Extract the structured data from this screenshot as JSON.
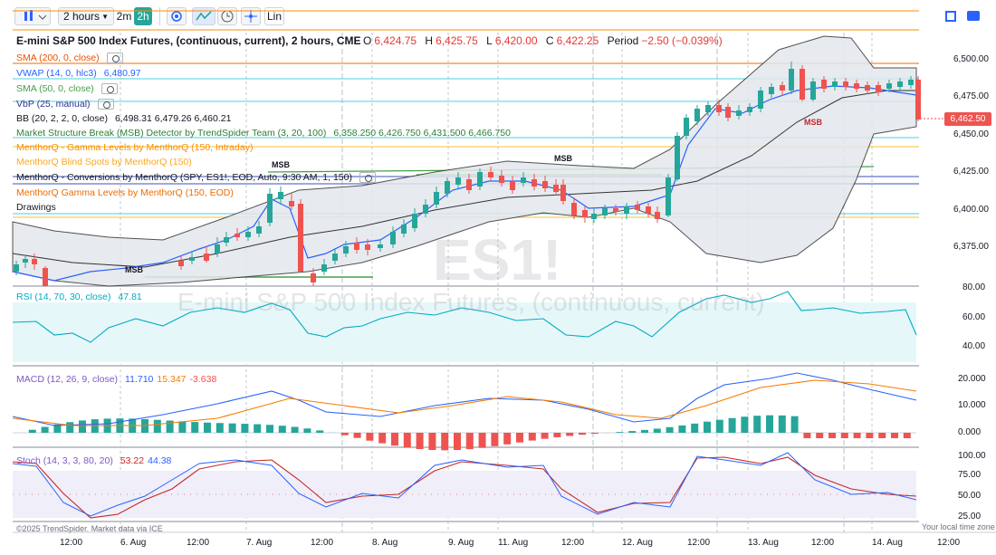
{
  "toolbar": {
    "interval_label": "2 hours",
    "btn_2m": "2m",
    "btn_2h": "2h",
    "lin_label": "Lin"
  },
  "chart": {
    "title": "E-mini S&P 500 Index Futures, (continuous, current), 2 hours, CME",
    "watermark_symbol": "ES1!",
    "watermark_name": "E-mini S&P 500 Index Futures, (continuous, current)",
    "ohlc": {
      "o_label": "O",
      "o": "6,424.75",
      "h_label": "H",
      "h": "6,425.75",
      "l_label": "L",
      "l": "6,420.00",
      "c_label": "C",
      "c": "6,422.25",
      "period_label": "Period",
      "period": "−2.50 (−0.039%)"
    },
    "last_price": "6,462.50"
  },
  "legends": {
    "sma200": "SMA (200, 0, close)",
    "vwap": "VWAP (14, 0, hlc3)",
    "vwap_val": "6,480.97",
    "sma50": "SMA (50, 0, close)",
    "vbp": "VbP (25, manual)",
    "bb": "BB (20, 2, 2, 0, close)",
    "bb_vals": "6,498.31  6,479.26  6,460.21",
    "msb": "Market Structure Break (MSB) Detector by TrendSpider Team (3, 20, 100)",
    "msb_vals": "6,358.250  6,426.750  6,431.500  6,466.750",
    "gamma_intraday": "MenthorQ - Gamma Levels by MenthorQ (150, Intraday)",
    "blind_spots": "MenthorQ Blind Spots by MenthorQ (150)",
    "conversions": "MenthorQ - Conversions by MenthorQ (SPY, ES1!, EOD, Auto, 9:30 AM, 1, 150)",
    "gamma_eod": "MenthorQ Gamma Levels by MenthorQ (150, EOD)",
    "drawings": "Drawings",
    "rsi": "RSI (14, 70, 30, close)",
    "rsi_val": "47.81",
    "macd": "MACD (12, 26, 9, close)",
    "macd_v1": "11.710",
    "macd_v2": "15.347",
    "macd_v3": "-3.638",
    "stoch": "Stoch (14, 3, 3, 80, 20)",
    "stoch_v1": "53.22",
    "stoch_v2": "44.38"
  },
  "labels": {
    "msb1": "MSB",
    "msb2": "MSB",
    "msb3": "MSB",
    "msb4": "MSB"
  },
  "price_axis": [
    "6,500.00",
    "6,475.00",
    "6,450.00",
    "6,425.00",
    "6,400.00",
    "6,375.00"
  ],
  "rsi_axis": [
    "80.00",
    "60.00",
    "40.00"
  ],
  "macd_axis": [
    "20.000",
    "10.000",
    "0.000"
  ],
  "stoch_axis": [
    "100.00",
    "75.00",
    "50.00",
    "25.00"
  ],
  "time_axis": [
    "12:00",
    "6. Aug",
    "12:00",
    "7. Aug",
    "12:00",
    "8. Aug",
    "9. Aug",
    "11. Aug",
    "12:00",
    "12. Aug",
    "12:00",
    "13. Aug",
    "12:00",
    "14. Aug",
    "12:00"
  ],
  "footer": {
    "credit": "©2025 TrendSpider. Market data via ICE",
    "timezone": "Your local time zone"
  },
  "colors": {
    "up": "#26a69a",
    "down": "#ef5350",
    "vwap": "#2962ff",
    "bb_fill": "#e3e7ec",
    "sma": "#f57c00"
  }
}
